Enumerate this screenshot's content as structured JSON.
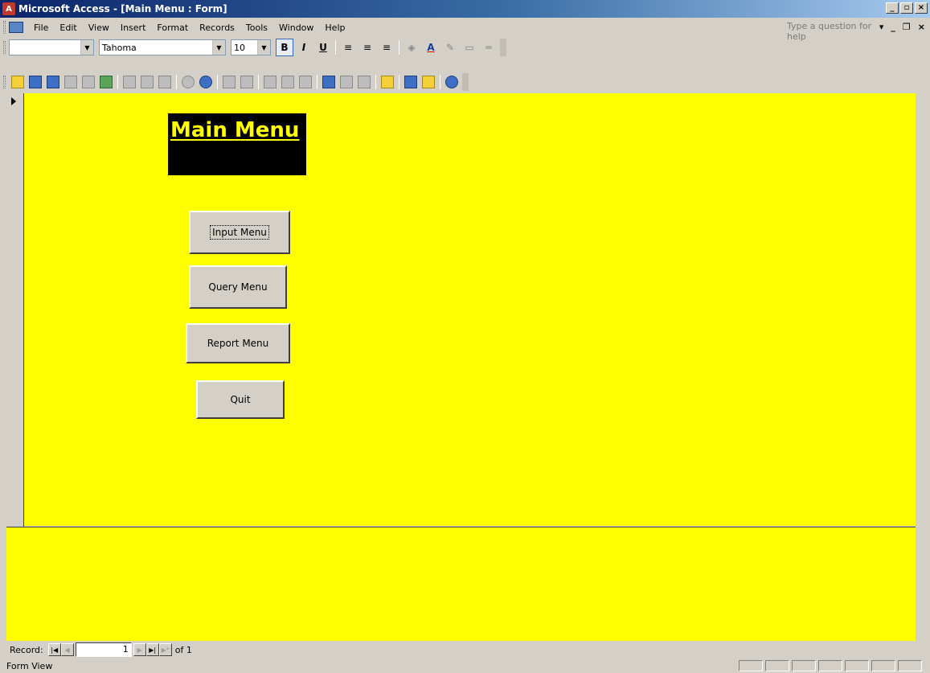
{
  "window": {
    "title": "Microsoft Access - [Main Menu : Form]",
    "controls": [
      "_",
      "🗗",
      "×"
    ]
  },
  "menubar": {
    "items": [
      "File",
      "Edit",
      "View",
      "Insert",
      "Format",
      "Records",
      "Tools",
      "Window",
      "Help"
    ],
    "help_placeholder": "Type a question for help"
  },
  "format_toolbar": {
    "object_combo": "",
    "font_name": "Tahoma",
    "font_size": "10",
    "bold": "B",
    "italic": "I",
    "underline": "U"
  },
  "form": {
    "heading": "Main Menu",
    "buttons": {
      "input": "Input Menu",
      "query": "Query Menu",
      "report": "Report Menu",
      "quit": "Quit"
    },
    "background_color": "#ffff00",
    "heading_bg": "#000000"
  },
  "record_nav": {
    "label": "Record:",
    "current": "1",
    "of_text": "of 1"
  },
  "status": {
    "text": "Form View"
  }
}
